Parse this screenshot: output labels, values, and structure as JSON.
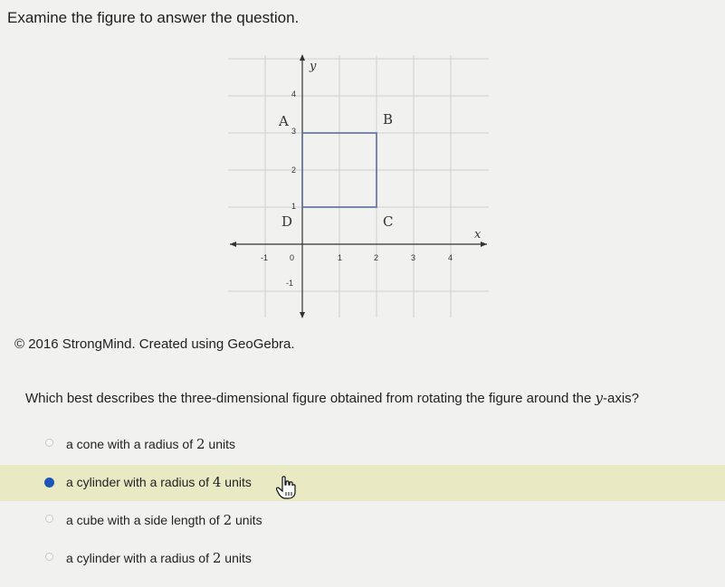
{
  "prompt": "Examine the figure to answer the question.",
  "figure": {
    "axis_x_label": "x",
    "axis_y_label": "y",
    "x_ticks": [
      "-1",
      "0",
      "1",
      "2",
      "3",
      "4"
    ],
    "y_ticks": [
      "4",
      "3",
      "2",
      "1",
      "-1"
    ],
    "points": {
      "A": "A",
      "B": "B",
      "C": "C",
      "D": "D"
    }
  },
  "credit": "© 2016 StrongMind. Created using GeoGebra.",
  "question": {
    "before": "Which best describes the three-dimensional figure obtained from rotating the figure around the ",
    "math": "y",
    "after": "-axis?"
  },
  "options": [
    {
      "pre": "a cone with a radius of ",
      "num": "2",
      "post": " units",
      "selected": false
    },
    {
      "pre": "a cylinder with a radius of ",
      "num": "4",
      "post": " units",
      "selected": true
    },
    {
      "pre": "a cube with a side length of ",
      "num": "2",
      "post": " units",
      "selected": false
    },
    {
      "pre": "a cylinder with a radius of ",
      "num": "2",
      "post": " units",
      "selected": false
    }
  ],
  "colors": {
    "selected_bg": "#e9e9c3",
    "radio_selected": "#1e56b8",
    "grid": "#c8c8c8",
    "square": "#5a6f9a"
  }
}
